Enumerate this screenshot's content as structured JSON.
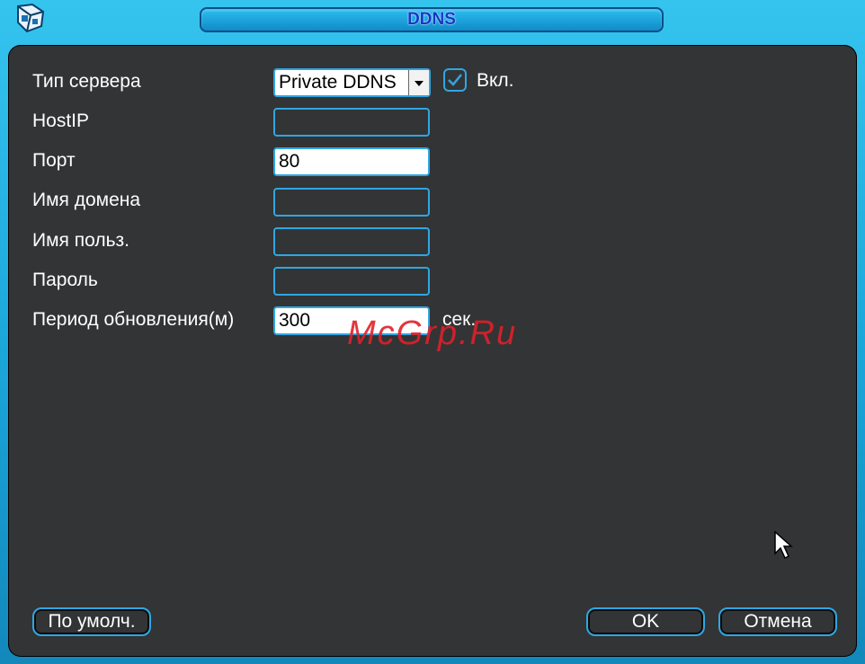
{
  "window": {
    "title": "DDNS"
  },
  "form": {
    "server_type_label": "Тип сервера",
    "server_type_value": "Private DDNS",
    "enable_label": "Вкл.",
    "enable_checked": true,
    "hostip_label": "HostIP",
    "hostip_value": "",
    "port_label": "Порт",
    "port_value": "80",
    "domain_label": "Имя домена",
    "domain_value": "",
    "username_label": "Имя польз.",
    "username_value": "",
    "password_label": "Пароль",
    "password_value": "",
    "update_period_label": "Период обновления(м)",
    "update_period_value": "300",
    "update_period_unit": "сек."
  },
  "buttons": {
    "default_label": "По умолч.",
    "ok_label": "OK",
    "cancel_label": "Отмена"
  },
  "watermark": "McGrp.Ru",
  "colors": {
    "frame": "#1aa5d9",
    "panel": "#333435",
    "field_border": "#2ea7e3",
    "title_text": "#1438c8",
    "watermark": "#e0202a"
  }
}
